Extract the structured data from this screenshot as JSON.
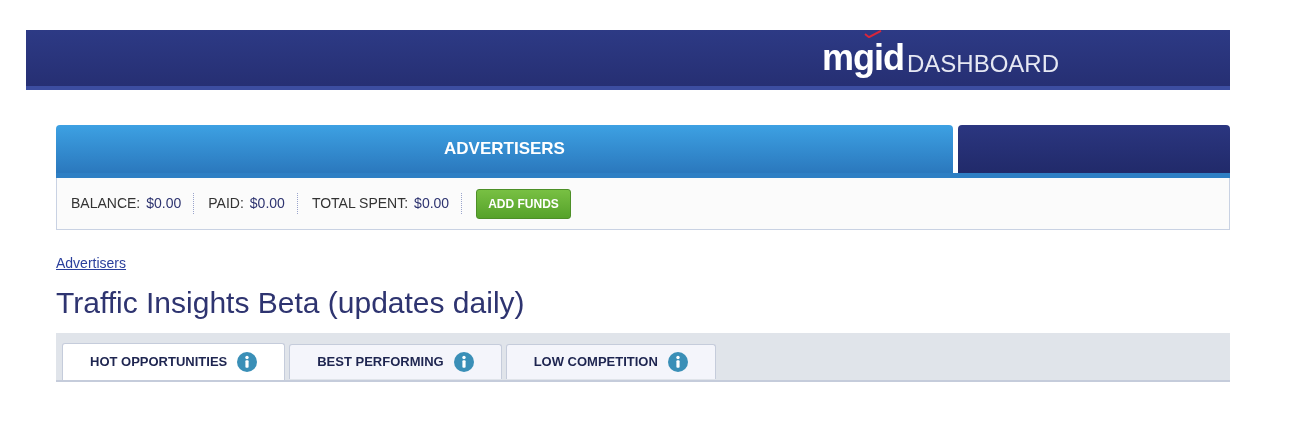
{
  "header": {
    "logo": "mgid",
    "title": "DASHBOARD"
  },
  "main_tabs": [
    {
      "label": "ADVERTISERS",
      "selected": true
    },
    {
      "selected": false
    }
  ],
  "stats": [
    {
      "label": "BALANCE:",
      "value": "$0.00"
    },
    {
      "label": "PAID:",
      "value": "$0.00"
    },
    {
      "label": "TOTAL SPENT:",
      "value": "$0.00"
    }
  ],
  "add_funds_button": "ADD FUNDS",
  "breadcrumb": "Advertisers",
  "page_title": "Traffic Insights Beta (updates daily)",
  "sub_tabs": [
    {
      "label": "HOT OPPORTUNITIES",
      "selected": true
    },
    {
      "label": "BEST PERFORMING",
      "selected": false
    },
    {
      "label": "LOW COMPETITION",
      "selected": false
    }
  ]
}
